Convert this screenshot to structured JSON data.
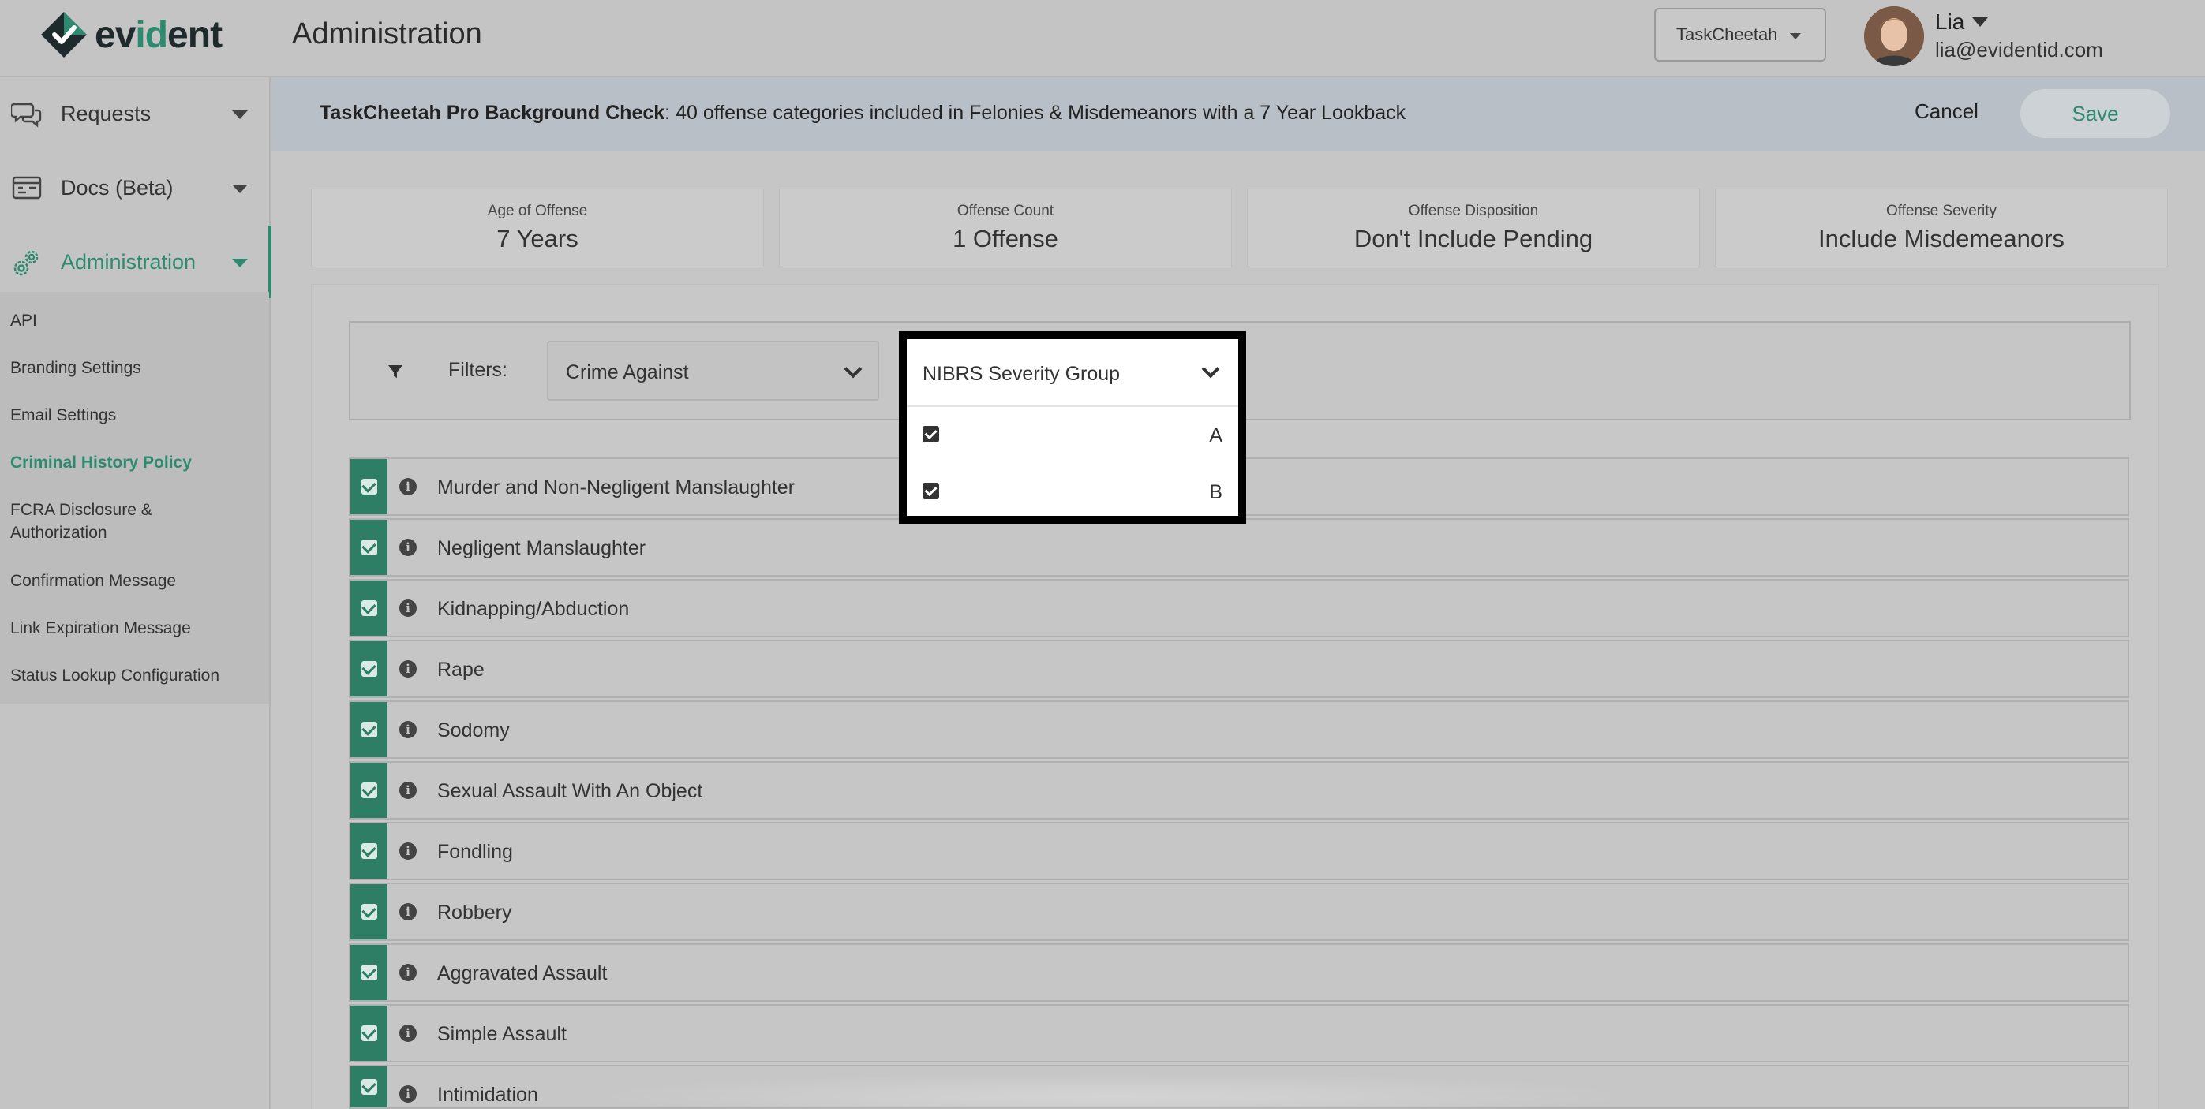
{
  "brand": {
    "name_prefix": "ev",
    "name_highlight": "id",
    "name_suffix": "ent",
    "accent": "#2d8a6e"
  },
  "header": {
    "title": "Administration",
    "tenant_select": "TaskCheetah",
    "user": {
      "name": "Lia",
      "email": "lia@evidentid.com"
    }
  },
  "sidebar": {
    "main": [
      {
        "label": "Requests",
        "icon": "chat-bubbles-icon"
      },
      {
        "label": "Docs (Beta)",
        "icon": "id-card-icon"
      },
      {
        "label": "Administration",
        "icon": "gears-icon",
        "active": true
      }
    ],
    "sub": [
      "API",
      "Branding Settings",
      "Email Settings",
      "Criminal History Policy",
      "FCRA Disclosure & Authorization",
      "Confirmation Message",
      "Link Expiration Message",
      "Status Lookup Configuration"
    ],
    "active_sub": "Criminal History Policy"
  },
  "banner": {
    "product": "TaskCheetah Pro Background Check",
    "summary": ": 40 offense categories included in Felonies & Misdemeanors with a 7 Year Lookback",
    "cancel": "Cancel",
    "save": "Save"
  },
  "settings_cards": [
    {
      "label": "Age of Offense",
      "value": "7 Years"
    },
    {
      "label": "Offense Count",
      "value": "1 Offense"
    },
    {
      "label": "Offense Disposition",
      "value": "Don't Include Pending"
    },
    {
      "label": "Offense Severity",
      "value": "Include Misdemeanors"
    }
  ],
  "filters": {
    "label": "Filters:",
    "crime_against": "Crime Against",
    "severity_group": {
      "label": "NIBRS Severity Group",
      "options": [
        {
          "label": "A",
          "checked": true
        },
        {
          "label": "B",
          "checked": true
        }
      ]
    }
  },
  "offenses": [
    "Murder and Non-Negligent Manslaughter",
    "Negligent Manslaughter",
    "Kidnapping/Abduction",
    "Rape",
    "Sodomy",
    "Sexual Assault With An Object",
    "Fondling",
    "Robbery",
    "Aggravated Assault",
    "Simple Assault",
    "Intimidation"
  ]
}
